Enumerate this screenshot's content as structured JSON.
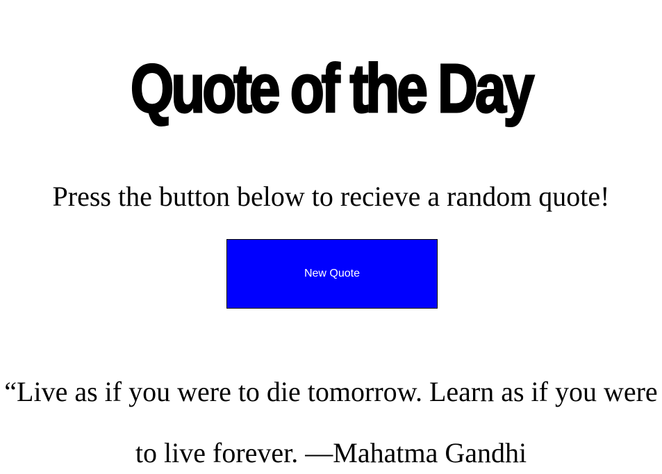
{
  "page": {
    "title": "Quote of the Day",
    "instructions": "Press the button below to recieve a random quote!",
    "button_label": "New Quote",
    "quote": "“Live as if you were to die tomorrow. Learn as if you were to live forever. —Mahatma Gandhi"
  },
  "colors": {
    "background": "#ffffff",
    "text": "#000000",
    "button_background": "#0000ff",
    "button_text": "#ffffff"
  }
}
